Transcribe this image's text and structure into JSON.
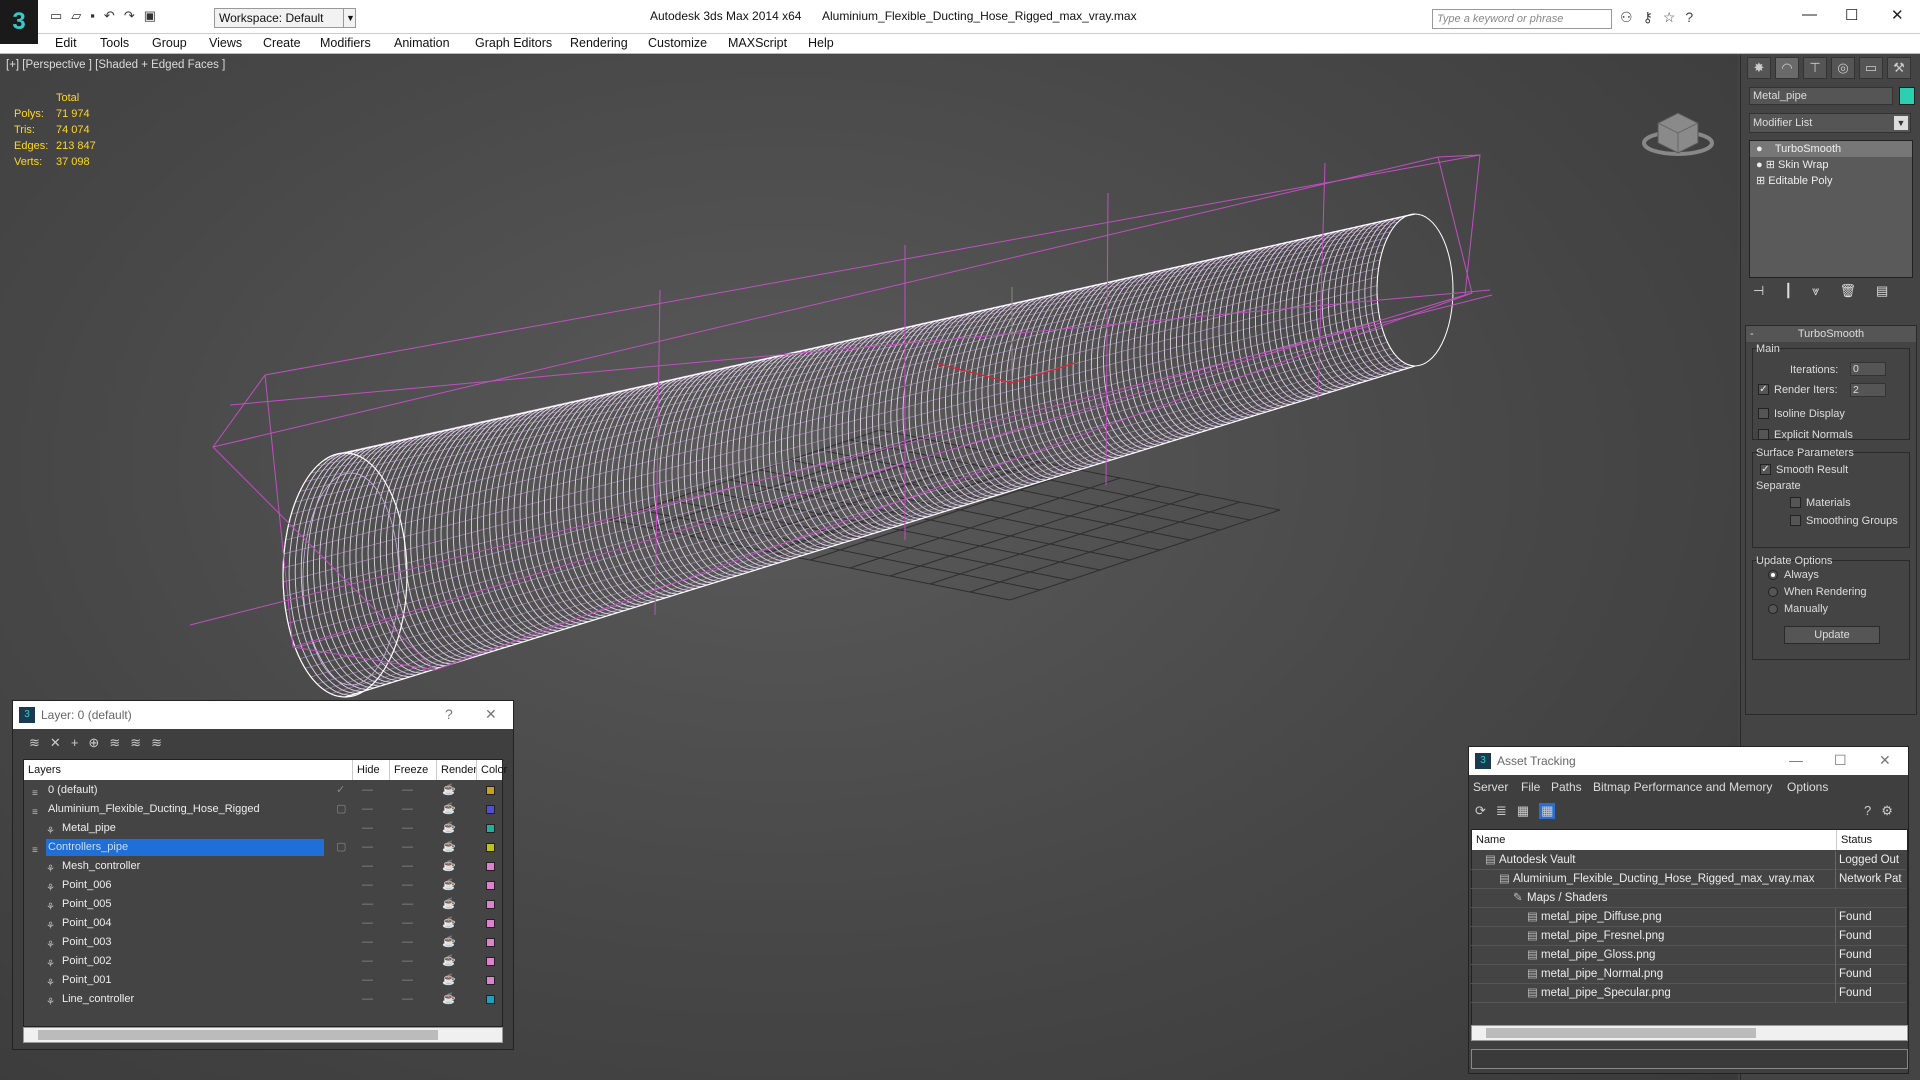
{
  "app": {
    "title": "Autodesk 3ds Max  2014 x64",
    "file": "Aluminium_Flexible_Ducting_Hose_Rigged_max_vray.max",
    "workspace": "Workspace: Default",
    "search_placeholder": "Type a keyword or phrase"
  },
  "menu": [
    "Edit",
    "Tools",
    "Group",
    "Views",
    "Create",
    "Modifiers",
    "Animation",
    "Graph Editors",
    "Rendering",
    "Customize",
    "MAXScript",
    "Help"
  ],
  "viewport": {
    "label": "[+] [Perspective ] [Shaded + Edged Faces ]",
    "stats_header": "Total",
    "stats": [
      {
        "k": "Polys:",
        "v": "71 974"
      },
      {
        "k": "Tris:",
        "v": "74 074"
      },
      {
        "k": "Edges:",
        "v": "213 847"
      },
      {
        "k": "Verts:",
        "v": "37 098"
      }
    ]
  },
  "command_panel": {
    "object_name": "Metal_pipe",
    "object_color": "#2ad0b0",
    "modifier_list": "Modifier List",
    "stack": [
      "TurboSmooth",
      "Skin Wrap",
      "Editable Poly"
    ],
    "turbosmooth": {
      "title": "TurboSmooth",
      "main": "Main",
      "iterations_label": "Iterations:",
      "iterations": "0",
      "render_iters_label": "Render Iters:",
      "render_iters": "2",
      "isoline": "Isoline Display",
      "explicit_normals": "Explicit Normals",
      "surface_params": "Surface Parameters",
      "smooth_result": "Smooth Result",
      "separate": "Separate",
      "materials": "Materials",
      "smoothing_groups": "Smoothing Groups",
      "update_options": "Update Options",
      "always": "Always",
      "when_rendering": "When Rendering",
      "manually": "Manually",
      "update_btn": "Update"
    }
  },
  "layer_dialog": {
    "title": "Layer: 0 (default)",
    "help": "?",
    "columns": {
      "layers": "Layers",
      "hide": "Hide",
      "freeze": "Freeze",
      "render": "Render",
      "color": "Color"
    },
    "rows": [
      {
        "name": "0 (default)",
        "indent": 0,
        "color": "#c8a020",
        "check": "✓",
        "sel": false
      },
      {
        "name": "Aluminium_Flexible_Ducting_Hose_Rigged",
        "indent": 0,
        "color": "#5050d0",
        "check": "▢",
        "sel": false
      },
      {
        "name": "Metal_pipe",
        "indent": 1,
        "color": "#20b0a0",
        "check": "",
        "sel": false
      },
      {
        "name": "Controllers_pipe",
        "indent": 0,
        "color": "#c0c020",
        "check": "▢",
        "sel": true
      },
      {
        "name": "Mesh_controller",
        "indent": 1,
        "color": "#e080d0",
        "check": "",
        "sel": false
      },
      {
        "name": "Point_006",
        "indent": 1,
        "color": "#e080d0",
        "check": "",
        "sel": false
      },
      {
        "name": "Point_005",
        "indent": 1,
        "color": "#e080d0",
        "check": "",
        "sel": false
      },
      {
        "name": "Point_004",
        "indent": 1,
        "color": "#e080d0",
        "check": "",
        "sel": false
      },
      {
        "name": "Point_003",
        "indent": 1,
        "color": "#e080d0",
        "check": "",
        "sel": false
      },
      {
        "name": "Point_002",
        "indent": 1,
        "color": "#e080d0",
        "check": "",
        "sel": false
      },
      {
        "name": "Point_001",
        "indent": 1,
        "color": "#e080d0",
        "check": "",
        "sel": false
      },
      {
        "name": "Line_controller",
        "indent": 1,
        "color": "#20a0c0",
        "check": "",
        "sel": false
      }
    ]
  },
  "asset_tracking": {
    "title": "Asset Tracking",
    "menu": [
      "Server",
      "File",
      "Paths",
      "Bitmap Performance and Memory",
      "Options"
    ],
    "columns": {
      "name": "Name",
      "status": "Status"
    },
    "rows": [
      {
        "name": "Autodesk Vault",
        "status": "Logged Out",
        "indent": 1
      },
      {
        "name": "Aluminium_Flexible_Ducting_Hose_Rigged_max_vray.max",
        "status": "Network Pat",
        "indent": 2
      },
      {
        "name": "Maps / Shaders",
        "status": "",
        "indent": 3
      },
      {
        "name": "metal_pipe_Diffuse.png",
        "status": "Found",
        "indent": 4
      },
      {
        "name": "metal_pipe_Fresnel.png",
        "status": "Found",
        "indent": 4
      },
      {
        "name": "metal_pipe_Gloss.png",
        "status": "Found",
        "indent": 4
      },
      {
        "name": "metal_pipe_Normal.png",
        "status": "Found",
        "indent": 4
      },
      {
        "name": "metal_pipe_Specular.png",
        "status": "Found",
        "indent": 4
      }
    ]
  }
}
